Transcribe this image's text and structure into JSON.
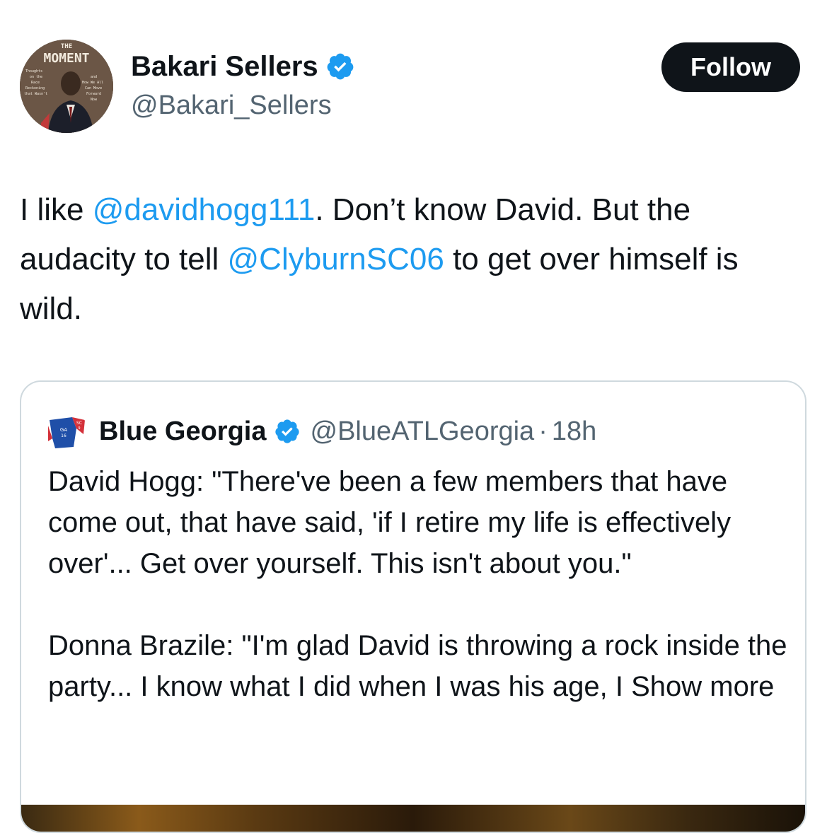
{
  "author": {
    "name": "Bakari Sellers",
    "handle": "@Bakari_Sellers",
    "verified": true,
    "avatar_text": {
      "top": "THE",
      "title": "MOMENT",
      "left": "Thoughts on the Race Reckoning that Wasn't",
      "right": "and How We All Can Move Forward Now"
    }
  },
  "follow_button": {
    "label": "Follow"
  },
  "tweet": {
    "parts": [
      {
        "text": "I like ",
        "mention": false
      },
      {
        "text": "@davidhogg111",
        "mention": true
      },
      {
        "text": ". Don’t know David. But the audacity to tell ",
        "mention": false
      },
      {
        "text": "@ClyburnSC06",
        "mention": true
      },
      {
        "text": " to get over himself is wild.",
        "mention": false
      }
    ]
  },
  "quote": {
    "name": "Blue Georgia",
    "handle": "@BlueATLGeorgia",
    "separator": "·",
    "time": "18h",
    "verified": true,
    "avatar_text": {
      "ga": "GA",
      "ga_num": "16",
      "sc": "SC",
      "sc_num": "9"
    },
    "paragraphs": [
      "David Hogg: \"There've been a few members that have come out, that have said, 'if I retire my life is effectively over'... Get over yourself. This isn't about you.\"",
      "Donna Brazile: \"I'm glad David is throwing a rock inside the party... I know what I did when I was his age, I Show more"
    ]
  },
  "colors": {
    "text": "#0f1419",
    "secondary": "#536471",
    "link": "#1d9bf0",
    "border": "#cfd9de",
    "follow_bg": "#0f1419"
  },
  "icons": [
    "verified-badge-icon"
  ]
}
